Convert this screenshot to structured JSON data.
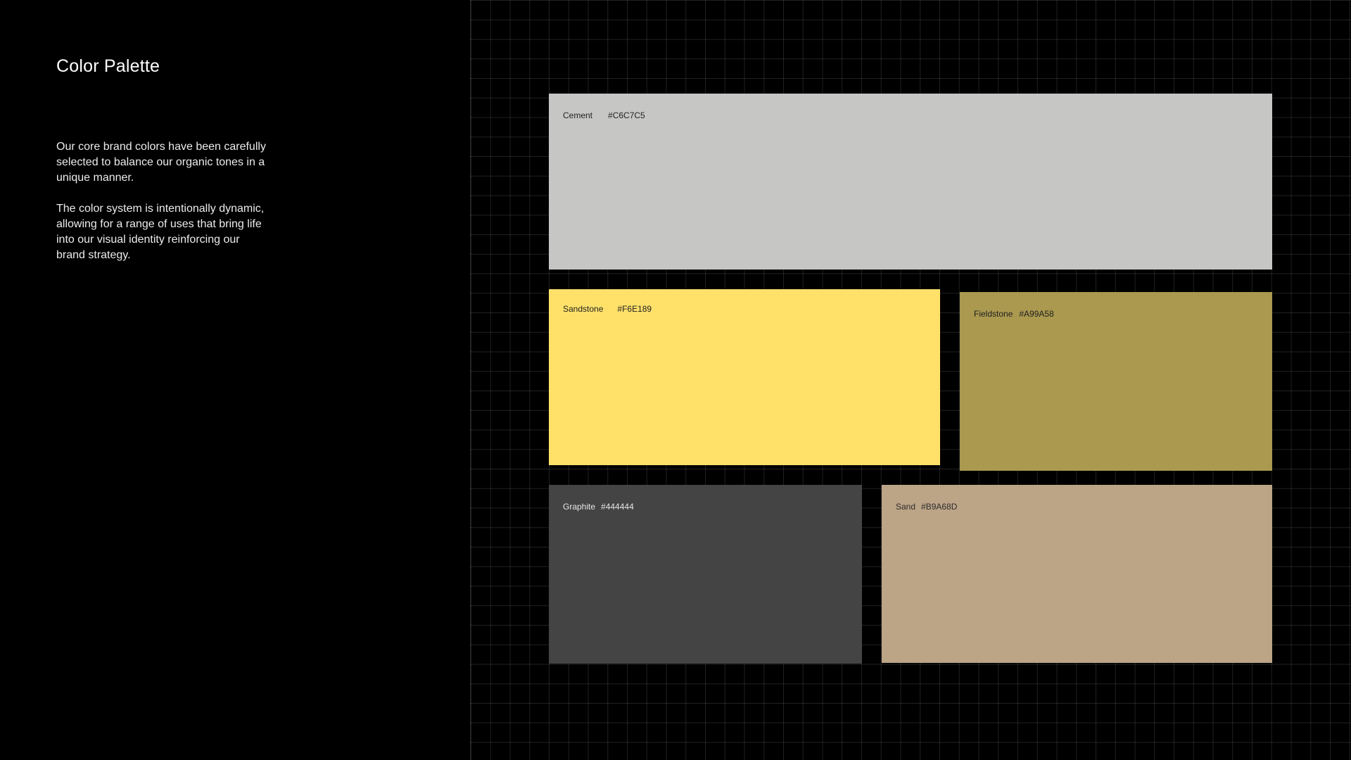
{
  "page": {
    "title": "Color Palette",
    "paragraphs": [
      "Our core brand colors have been carefully selected to balance our organic tones in a unique manner.",
      "The color system is intentionally dynamic, allowing for a range of uses that bring life into our visual identity reinforcing our brand strategy."
    ]
  },
  "palette": {
    "cement": {
      "name": "Cement",
      "hex": "#C6C7C5",
      "color": "#C6C7C5"
    },
    "sandstone": {
      "name": "Sandstone",
      "hex": "#F6E189",
      "color": "#FFE16A"
    },
    "fieldstone": {
      "name": "Fieldstone",
      "hex": "#A99A58",
      "color": "#AA994F"
    },
    "graphite": {
      "name": "Graphite",
      "hex": "#444444",
      "color": "#444444"
    },
    "sand": {
      "name": "Sand",
      "hex": "#B9A68D",
      "color": "#BCA487"
    }
  },
  "colors": {
    "background": "#000000",
    "text": "#FFFFFF",
    "grid_line": "#333333"
  }
}
